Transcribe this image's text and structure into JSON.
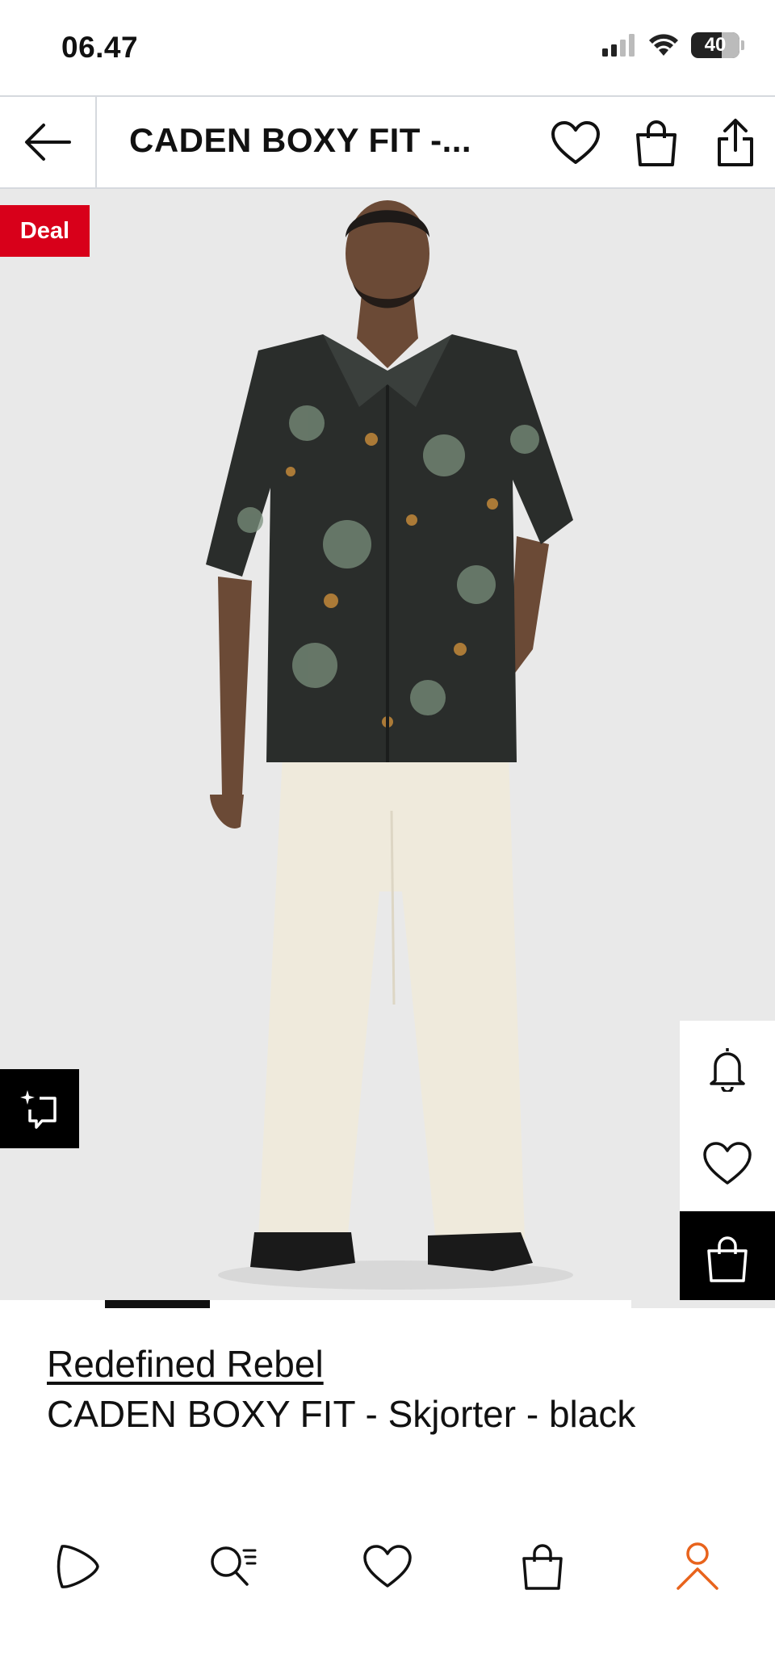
{
  "status_bar": {
    "time": "06.47",
    "battery": "40",
    "icons": [
      "cellular-signal-icon",
      "wifi-icon",
      "battery-icon"
    ]
  },
  "header": {
    "title": "CADEN BOXY FIT -...",
    "icons": [
      "back-arrow-icon",
      "heart-icon",
      "shopping-bag-icon",
      "share-icon"
    ]
  },
  "hero": {
    "deal_badge": "Deal",
    "deal_color": "#d8001a",
    "background": "#e9e9e9",
    "side_actions": [
      "bell-icon",
      "heart-icon",
      "shopping-bag-icon"
    ],
    "style_button_icon": "sparkle-frame-icon",
    "carousel_active_index": 1
  },
  "product": {
    "brand": "Redefined Rebel",
    "name": "CADEN BOXY FIT - Skjorter - black"
  },
  "bottom_nav": {
    "items": [
      "play-icon",
      "search-list-icon",
      "heart-icon",
      "shopping-bag-icon",
      "profile-icon"
    ],
    "active": "profile-icon",
    "active_color": "#e8631c"
  }
}
